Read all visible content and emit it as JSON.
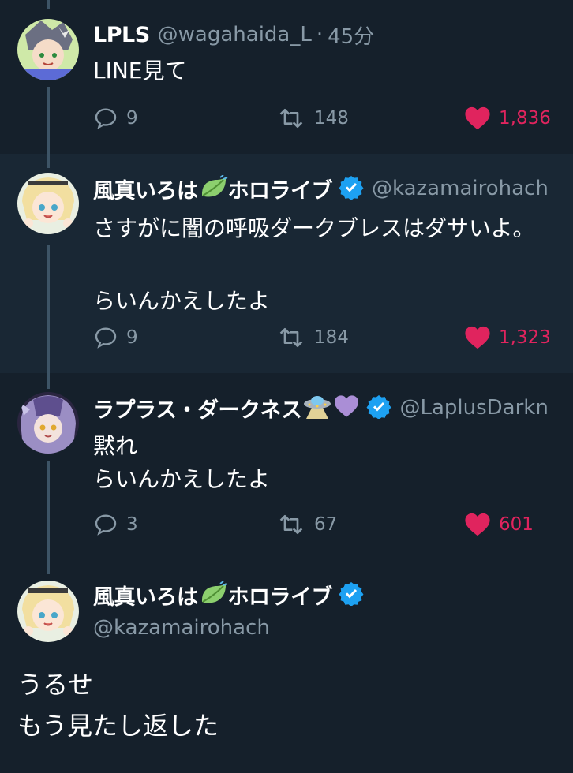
{
  "tweets": [
    {
      "name": "LPLS",
      "handle": "@wagahaida_L",
      "separator": "·",
      "time": "45分",
      "text": "LINE見て",
      "replies": "9",
      "retweets": "148",
      "likes": "1,836"
    },
    {
      "name": "風真いろは",
      "name_suffix": "ホロライブ",
      "handle": "@kazamairohach",
      "text": "さすがに闇の呼吸ダークブレスはダサいよ。\n\nらいんかえしたよ",
      "replies": "9",
      "retweets": "184",
      "likes": "1,323"
    },
    {
      "name": "ラプラス・ダークネス",
      "handle": "@LaplusDarkn",
      "text": "黙れ\nらいんかえしたよ",
      "replies": "3",
      "retweets": "67",
      "likes": "601"
    },
    {
      "name": "風真いろは",
      "name_suffix": "ホロライブ",
      "handle": "@kazamairohach",
      "text": "うるせ\nもう見たし返した"
    }
  ],
  "icons": {
    "reply": "reply-icon",
    "retweet": "retweet-icon",
    "like": "heart-icon",
    "verified": "verified-badge-icon",
    "leaf": "leaf-emoji-icon",
    "ufo": "ufo-emoji-icon",
    "purple_heart": "purple-heart-emoji-icon"
  },
  "colors": {
    "background": "#15202b",
    "alt_background": "#192734",
    "secondary_text": "#8899a6",
    "like": "#e0245e",
    "verified": "#1da1f2",
    "thread_line": "#3d5466"
  }
}
